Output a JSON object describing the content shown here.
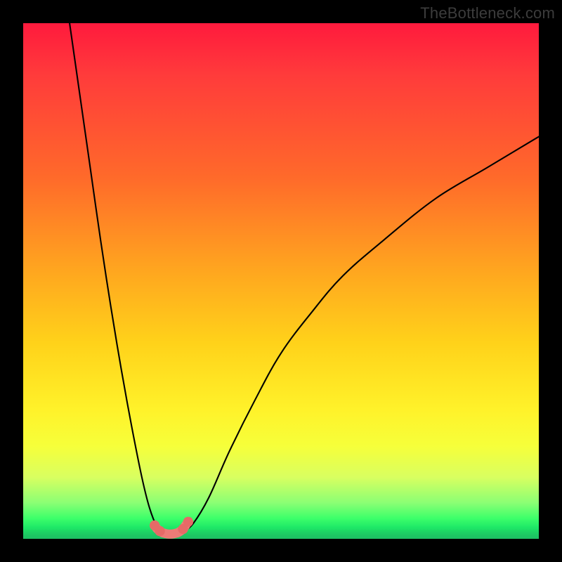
{
  "watermark": "TheBottleneck.com",
  "chart_data": {
    "type": "line",
    "title": "",
    "xlabel": "",
    "ylabel": "",
    "xlim": [
      0,
      100
    ],
    "ylim": [
      0,
      100
    ],
    "grid": false,
    "legend": "none",
    "annotations": [],
    "background_gradient_meaning": "top = high bottleneck (red), bottom = low (green)",
    "series": [
      {
        "name": "left-descending-curve",
        "x": [
          9,
          11,
          13,
          15,
          17,
          19,
          21,
          23,
          24.5,
          26,
          27
        ],
        "values": [
          100,
          86,
          72,
          58,
          45,
          33,
          22,
          12,
          6,
          2.2,
          1.3
        ]
      },
      {
        "name": "right-ascending-curve",
        "x": [
          31,
          33,
          36,
          40,
          45,
          50,
          56,
          62,
          70,
          80,
          90,
          100
        ],
        "values": [
          1.3,
          3,
          8,
          17,
          27,
          36,
          44,
          51,
          58,
          66,
          72,
          78
        ]
      },
      {
        "name": "valley-highlight",
        "style": "thick-salmon-with-dots",
        "x": [
          25.5,
          26.0,
          26.5,
          27.0,
          27.5,
          28.0,
          28.5,
          29.0,
          29.5,
          30.0,
          30.5,
          31.0,
          31.5,
          32.0
        ],
        "values": [
          2.6,
          1.9,
          1.5,
          1.2,
          1.05,
          0.95,
          0.92,
          0.95,
          1.05,
          1.2,
          1.5,
          1.9,
          2.6,
          3.3
        ]
      }
    ]
  }
}
